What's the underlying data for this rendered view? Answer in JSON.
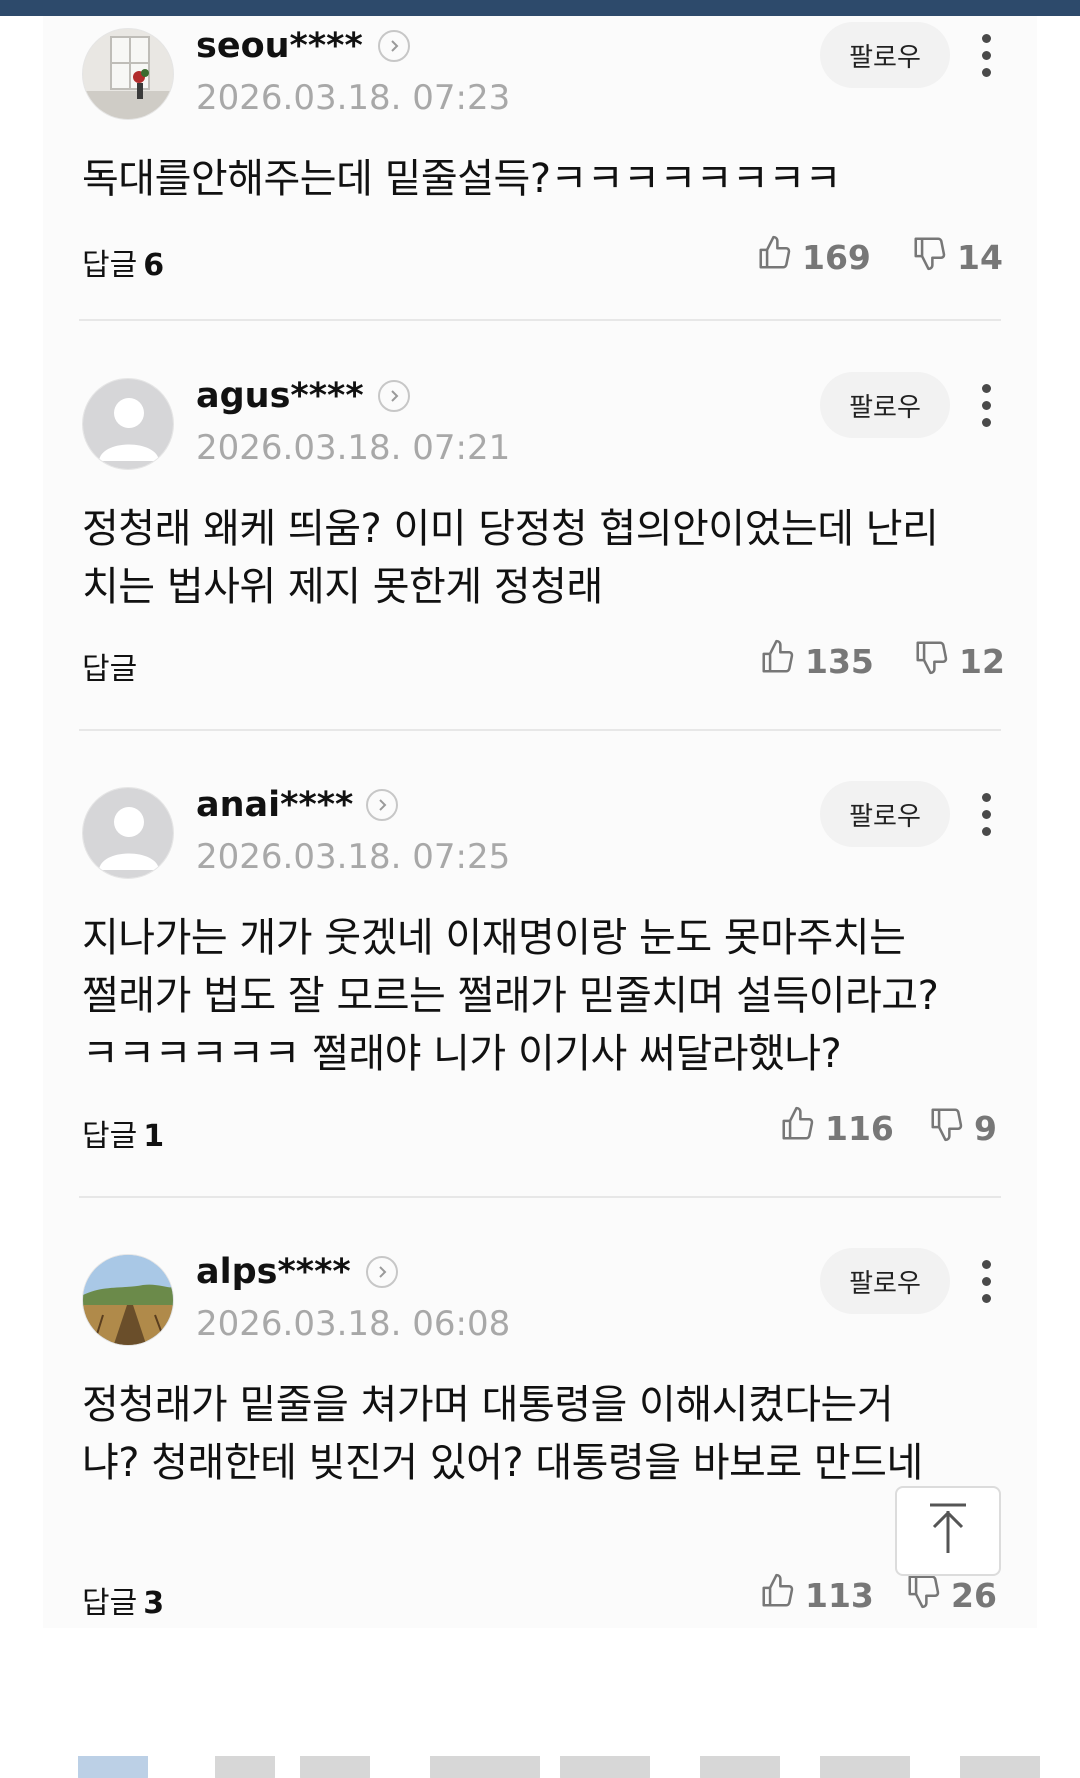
{
  "comments": [
    {
      "username": "seou****",
      "date": "2026.03.18. 07:23",
      "follow_label": "팔로우",
      "text": "독대를안해주는데 밑줄설득?ㅋㅋㅋㅋㅋㅋㅋㅋ",
      "reply_label": "답글",
      "reply_count": "6",
      "likes": "169",
      "dislikes": "14",
      "avatar": "window-photo"
    },
    {
      "username": "agus****",
      "date": "2026.03.18. 07:21",
      "follow_label": "팔로우",
      "text": "정청래 왜케 띄움? 이미 당정청 협의안이었는데 난리치는 법사위 제지 못한게 정청래",
      "reply_label": "답글",
      "reply_count": "",
      "likes": "135",
      "dislikes": "12",
      "avatar": "default-person"
    },
    {
      "username": "anai****",
      "date": "2026.03.18. 07:25",
      "follow_label": "팔로우",
      "text": "지나가는 개가 웃겠네 이재명이랑 눈도 못마주치는 쩔래가 법도 잘 모르는 쩔래가 믿줄치며 설득이라고? ㅋㅋㅋㅋㅋㅋ 쩔래야 니가 이기사 써달라했나?",
      "reply_label": "답글",
      "reply_count": "1",
      "likes": "116",
      "dislikes": "9",
      "avatar": "default-person"
    },
    {
      "username": "alps****",
      "date": "2026.03.18. 06:08",
      "follow_label": "팔로우",
      "text": "정청래가 밑줄을 쳐가며 대통령을 이해시켰다는거냐? 청래한테 빚진거 있어? 대통령을 바보로 만드네",
      "reply_label": "답글",
      "reply_count": "3",
      "likes": "113",
      "dislikes": "26",
      "avatar": "landscape-photo"
    }
  ],
  "icons": {
    "like": "thumbs-up-icon",
    "dislike": "thumbs-down-icon",
    "more": "more-vertical-icon",
    "profile": "chevron-right-icon",
    "scroll_top": "arrow-up-icon"
  },
  "colors": {
    "header_bar": "#2d4a6b",
    "date_text": "#a8a8a8",
    "count_text": "#777777"
  }
}
